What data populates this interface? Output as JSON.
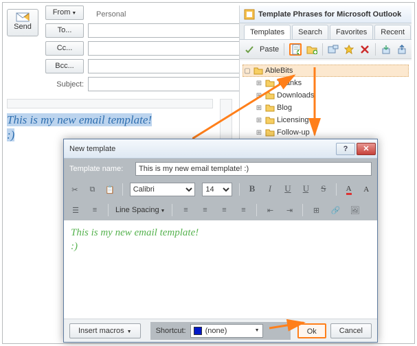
{
  "compose": {
    "send": "Send",
    "from": "From",
    "to": "To...",
    "cc": "Cc...",
    "bcc": "Bcc...",
    "subject": "Subject:",
    "personal": "Personal",
    "body_line1": "This is my new email template!",
    "body_line2": ":)"
  },
  "panel": {
    "title": "Template Phrases for Microsoft Outlook",
    "tabs": [
      "Templates",
      "Search",
      "Favorites",
      "Recent"
    ],
    "paste": "Paste",
    "tree_root": "AbleBits",
    "tree_items": [
      "Thanks",
      "Downloads",
      "Blog",
      "Licensing",
      "Follow-up"
    ]
  },
  "dialog": {
    "title": "New template",
    "name_label": "Template name:",
    "name_value": "This is my new email template! :)",
    "font": "Calibri",
    "size": "14",
    "line_spacing": "Line Spacing",
    "body_line1": "This is my new email template!",
    "body_line2": ":)",
    "insert_macros": "Insert macros",
    "shortcut_label": "Shortcut:",
    "shortcut_value": "(none)",
    "ok": "Ok",
    "cancel": "Cancel"
  }
}
